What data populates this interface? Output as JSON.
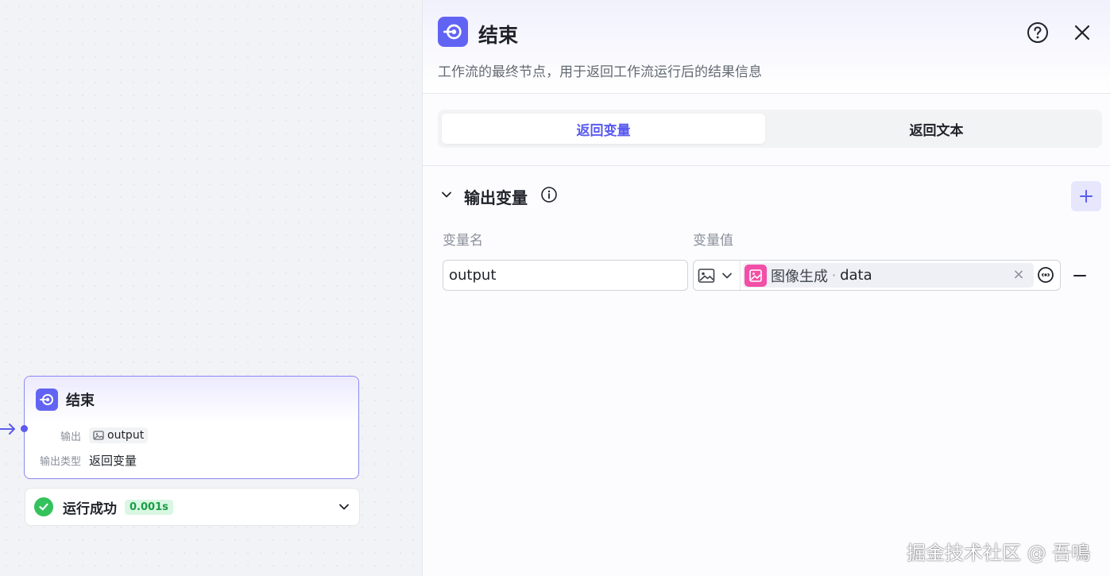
{
  "canvas": {
    "node": {
      "title": "结束",
      "output_label": "输出",
      "output_value": "output",
      "output_type_label": "输出类型",
      "output_type_value": "返回变量"
    },
    "run": {
      "status": "运行成功",
      "duration": "0.001s"
    }
  },
  "panel": {
    "title": "结束",
    "description": "工作流的最终节点，用于返回工作流运行后的结果信息",
    "tabs": [
      {
        "label": "返回变量",
        "active": true
      },
      {
        "label": "返回文本",
        "active": false
      }
    ],
    "section": {
      "title": "输出变量",
      "col_name": "变量名",
      "col_value": "变量值"
    },
    "row": {
      "name": "output",
      "ref_node": "图像生成",
      "ref_sep": "·",
      "ref_field": "data"
    }
  },
  "watermark": "掘金技术社区 @ 吾鳴",
  "colors": {
    "accent": "#5b5bf0",
    "success": "#33c25b",
    "image_node": "#f24fa8"
  }
}
